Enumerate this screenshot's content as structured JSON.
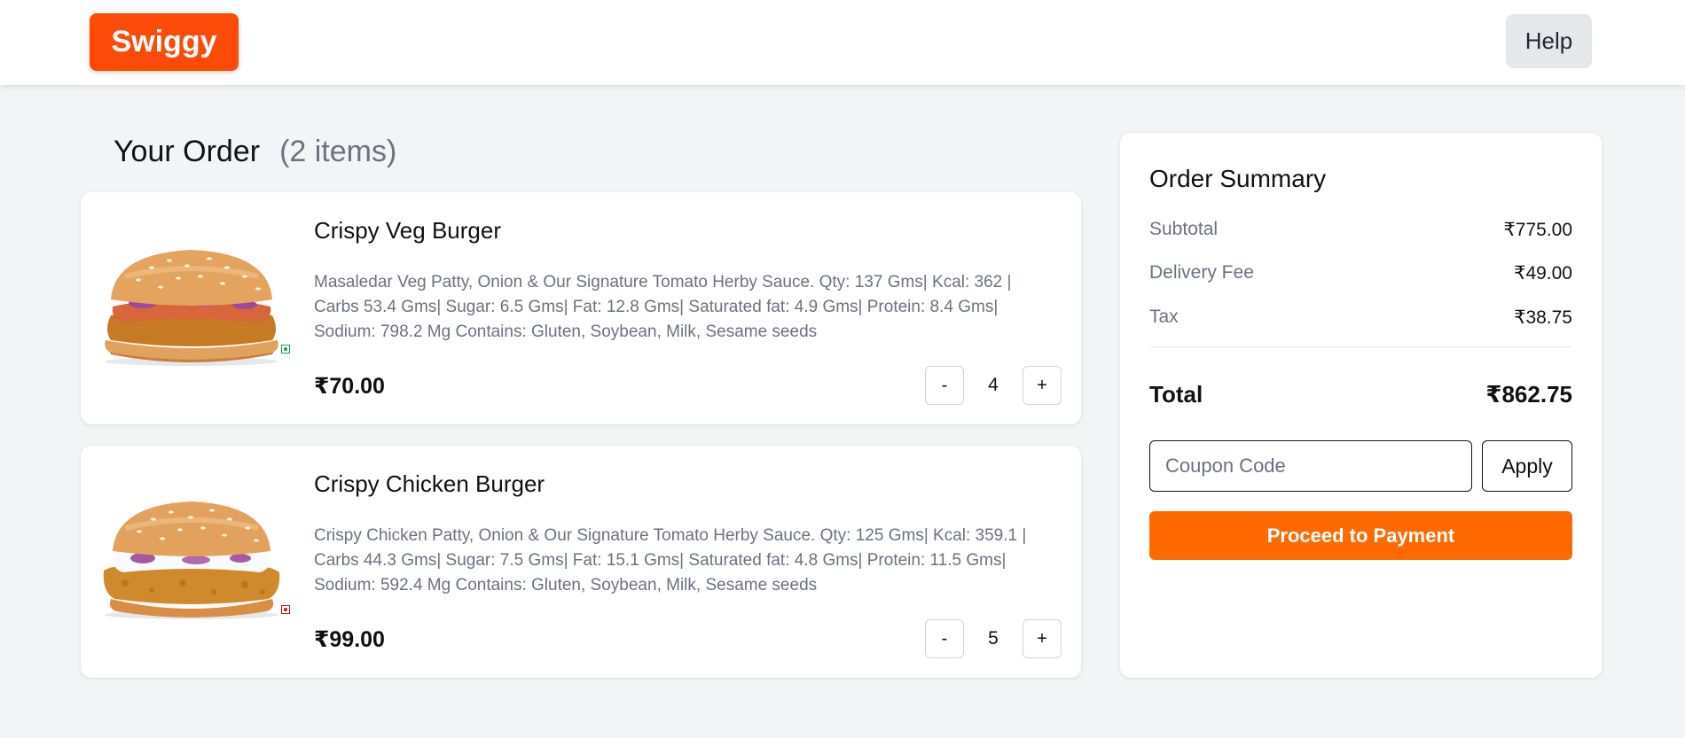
{
  "header": {
    "logo_text": "Swiggy",
    "help_label": "Help"
  },
  "order": {
    "title": "Your Order",
    "count_label": "(2 items)",
    "items": [
      {
        "name": "Crispy Veg Burger",
        "description": "Masaledar Veg Patty, Onion & Our Signature Tomato Herby Sauce. Qty: 137 Gms| Kcal: 362 | Carbs 53.4 Gms| Sugar: 6.5 Gms| Fat: 12.8 Gms| Saturated fat: 4.9 Gms| Protein: 8.4 Gms| Sodium: 798.2 Mg Contains: Gluten, Soybean, Milk, Sesame seeds",
        "price": "₹70.00",
        "quantity": "4",
        "minus_label": "-",
        "plus_label": "+",
        "diet": "veg",
        "diet_color": "#16a34a"
      },
      {
        "name": "Crispy Chicken Burger",
        "description": "Crispy Chicken Patty, Onion & Our Signature Tomato Herby Sauce. Qty: 125 Gms| Kcal: 359.1 | Carbs 44.3 Gms| Sugar: 7.5 Gms| Fat: 15.1 Gms| Saturated fat: 4.8 Gms| Protein: 11.5 Gms| Sodium: 592.4 Mg Contains: Gluten, Soybean, Milk, Sesame seeds",
        "price": "₹99.00",
        "quantity": "5",
        "minus_label": "-",
        "plus_label": "+",
        "diet": "non-veg",
        "diet_color": "#b91c1c"
      }
    ]
  },
  "summary": {
    "title": "Order Summary",
    "subtotal_label": "Subtotal",
    "subtotal_value": "₹775.00",
    "delivery_label": "Delivery Fee",
    "delivery_value": "₹49.00",
    "tax_label": "Tax",
    "tax_value": "₹38.75",
    "total_label": "Total",
    "total_value": "₹862.75",
    "coupon_placeholder": "Coupon Code",
    "apply_label": "Apply",
    "pay_label": "Proceed to Payment"
  },
  "colors": {
    "brand": "#fc4a08",
    "pay_button": "#ff6a00"
  }
}
